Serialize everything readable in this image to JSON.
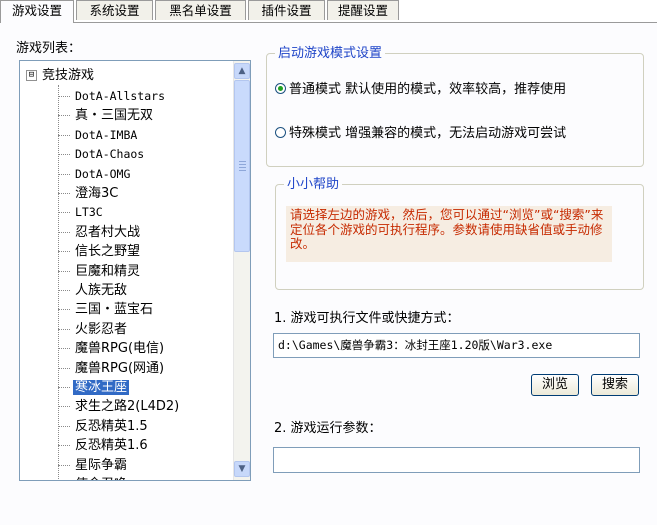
{
  "tabs": [
    {
      "label": "游戏设置",
      "active": true
    },
    {
      "label": "系统设置",
      "active": false
    },
    {
      "label": "黑名单设置",
      "active": false
    },
    {
      "label": "插件设置",
      "active": false
    },
    {
      "label": "提醒设置",
      "active": false
    }
  ],
  "left": {
    "list_label": "游戏列表：",
    "tree_root": "竞技游戏",
    "expander": "⊟",
    "items": [
      "DotA-Allstars",
      "真・三国无双",
      "DotA-IMBA",
      "DotA-Chaos",
      "DotA-OMG",
      "澄海3C",
      "LT3C",
      "忍者村大战",
      "信长之野望",
      "巨魔和精灵",
      "人族无敌",
      "三国・蓝宝石",
      "火影忍者",
      "魔兽RPG(电信)",
      "魔兽RPG(网通)",
      "寒冰王座",
      "求生之路2(L4D2)",
      "反恐精英1.5",
      "反恐精英1.6",
      "星际争霸",
      "使命召唤"
    ],
    "selected_index": 15,
    "scroll_up": "▲",
    "scroll_down": "▼"
  },
  "mode": {
    "title": "启动游戏模式设置",
    "options": [
      {
        "label": "普通模式 默认使用的模式，效率较高，推荐使用",
        "checked": true
      },
      {
        "label": "特殊模式 增强兼容的模式，无法启动游戏可尝试",
        "checked": false
      }
    ]
  },
  "help": {
    "title": "小小帮助",
    "text": "请选择左边的游戏，然后，您可以通过“浏览”或“搜索”来定位各个游戏的可执行程序。参数请使用缺省值或手动修改。"
  },
  "exe": {
    "label": "1. 游戏可执行文件或快捷方式：",
    "value": "d:\\Games\\魔兽争霸3：冰封王座1.20版\\War3.exe",
    "browse": "浏览",
    "search": "搜索"
  },
  "params": {
    "label": "2. 游戏运行参数：",
    "value": ""
  }
}
